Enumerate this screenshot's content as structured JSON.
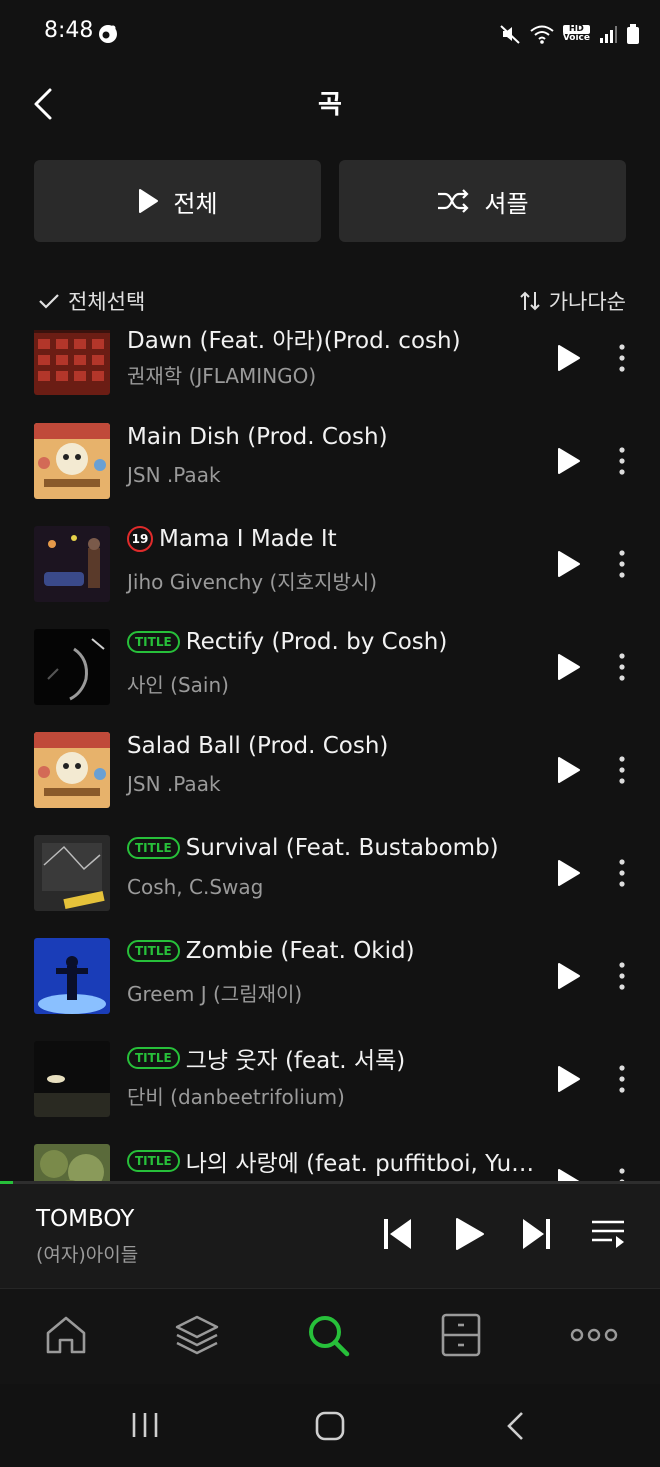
{
  "status": {
    "time": "8:48",
    "hd_top": "HD",
    "hd_bottom": "Voice"
  },
  "header": {
    "title": "곡"
  },
  "actions": {
    "play_all": "전체",
    "shuffle": "셔플"
  },
  "toolbar": {
    "select_all": "전체선택",
    "sort": "가나다순"
  },
  "songs": [
    {
      "title": "Dawn (Feat. 아라)(Prod. cosh)",
      "artist": "권재학 (JFLAMINGO)",
      "badge": ""
    },
    {
      "title": "Main Dish (Prod. Cosh)",
      "artist": "JSN .Paak",
      "badge": ""
    },
    {
      "title": "Mama I Made It",
      "artist": "Jiho Givenchy (지호지방시)",
      "badge": "19"
    },
    {
      "title": "Rectify (Prod. by Cosh)",
      "artist": "사인 (Sain)",
      "badge": "TITLE"
    },
    {
      "title": "Salad Ball (Prod. Cosh)",
      "artist": "JSN .Paak",
      "badge": ""
    },
    {
      "title": "Survival (Feat. Bustabomb)",
      "artist": "Cosh, C.Swag",
      "badge": "TITLE"
    },
    {
      "title": "Zombie (Feat. Okid)",
      "artist": "Greem J (그림재이)",
      "badge": "TITLE"
    },
    {
      "title": "그냥 웃자 (feat. 서록)",
      "artist": "단비 (danbeetrifolium)",
      "badge": "TITLE"
    },
    {
      "title": "나의 사랑에 (feat. puffitboi, Yu…",
      "artist": "",
      "badge": "TITLE"
    }
  ],
  "now_playing": {
    "title": "TOMBOY",
    "artist": "(여자)아이들",
    "progress_fraction": 0.02
  },
  "colors": {
    "accent": "#27c03a",
    "explicit": "#e02b2b",
    "background": "#121212",
    "button_bg": "#2a2a2a"
  },
  "icons": {
    "nav": [
      "home-icon",
      "library-icon",
      "search-icon",
      "storage-icon",
      "more-icon"
    ],
    "active_nav": "search-icon"
  }
}
